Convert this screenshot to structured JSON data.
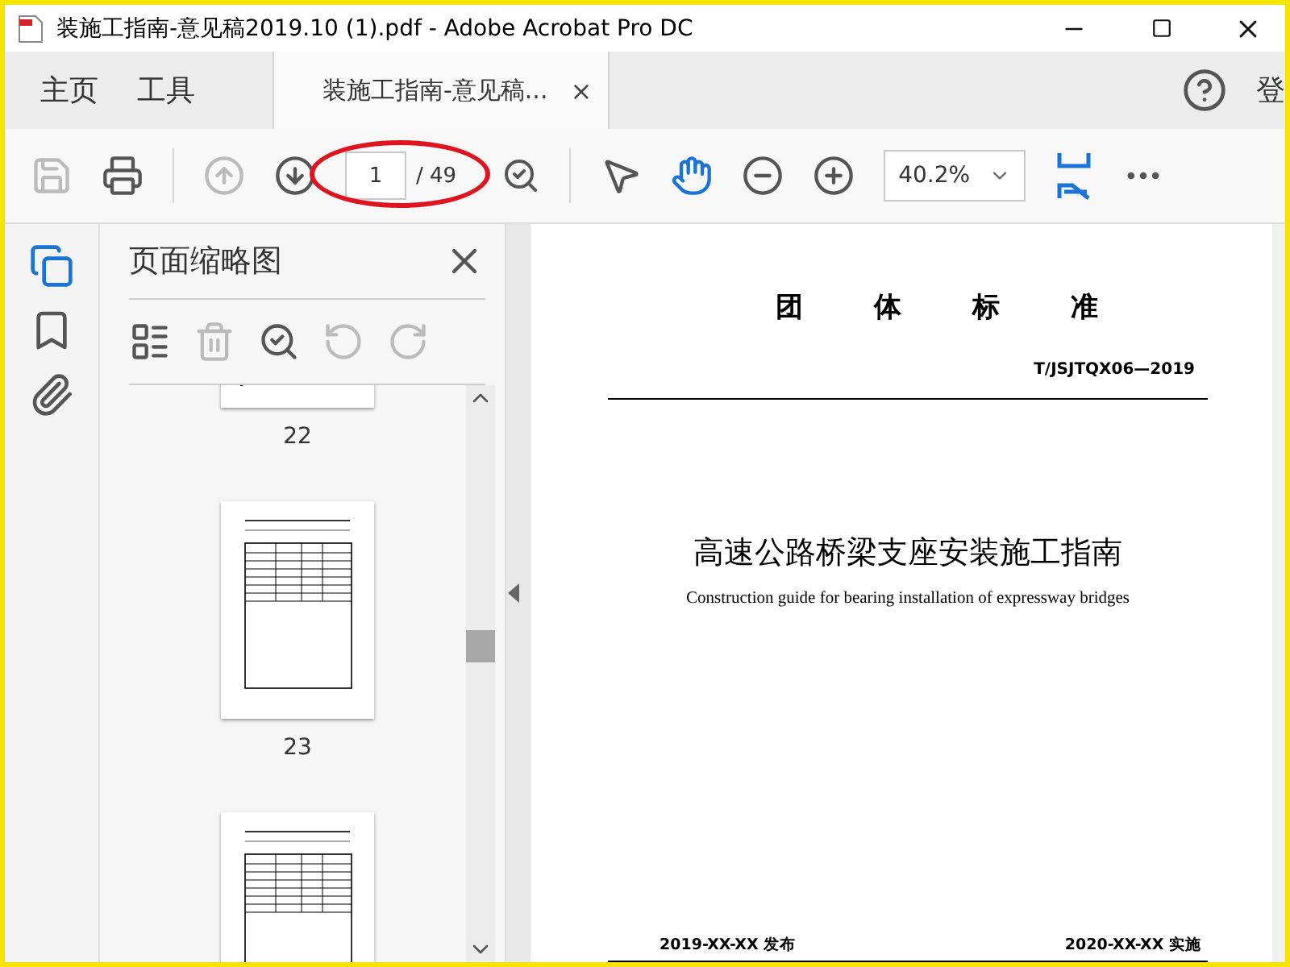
{
  "window": {
    "title": "装施工指南-意见稿2019.10 (1).pdf - Adobe Acrobat Pro DC"
  },
  "tabs": [
    {
      "label": "主页",
      "kind": "nav",
      "selected": false
    },
    {
      "label": "工具",
      "kind": "nav",
      "selected": false
    },
    {
      "label": "装施工指南-意见稿...",
      "kind": "document",
      "selected": true,
      "close": "×"
    }
  ],
  "account": {
    "label": "登"
  },
  "toolbar": {
    "tools": [
      {
        "kind": "save",
        "disabled": true
      },
      {
        "kind": "print",
        "disabled": false
      },
      {
        "kind": "prev-page",
        "disabled": true
      },
      {
        "kind": "next-page",
        "disabled": false
      }
    ],
    "page_current": "1",
    "page_total": "/ 49",
    "pointer_tools": [
      {
        "kind": "select",
        "selected": false
      },
      {
        "kind": "hand",
        "selected": true
      },
      {
        "kind": "zoom-out",
        "selected": false
      },
      {
        "kind": "zoom-in",
        "selected": false
      }
    ],
    "zoom": "40.2%"
  },
  "rail": [
    {
      "kind": "thumbnails",
      "selected": true
    },
    {
      "kind": "bookmarks",
      "selected": false
    },
    {
      "kind": "attachments",
      "selected": false
    }
  ],
  "panel": {
    "title": "页面缩略图",
    "tools": [
      {
        "kind": "options",
        "disabled": false
      },
      {
        "kind": "delete",
        "disabled": true
      },
      {
        "kind": "insert",
        "disabled": false
      },
      {
        "kind": "rotate-left",
        "disabled": true
      },
      {
        "kind": "rotate-right",
        "disabled": true
      }
    ],
    "thumbnails": [
      {
        "label": "22",
        "selected": false
      },
      {
        "label": "23",
        "selected": false
      },
      {
        "selected": false
      }
    ]
  },
  "document": {
    "heading": [
      "团",
      "体",
      "标",
      "准"
    ],
    "code": "T/JSJTQX06—2019",
    "title": "高速公路桥梁支座安装施工指南",
    "subtitle": "Construction guide for bearing installation of expressway bridges",
    "published": "2019-XX-XX 发布",
    "effective": "2020-XX-XX 实施"
  }
}
